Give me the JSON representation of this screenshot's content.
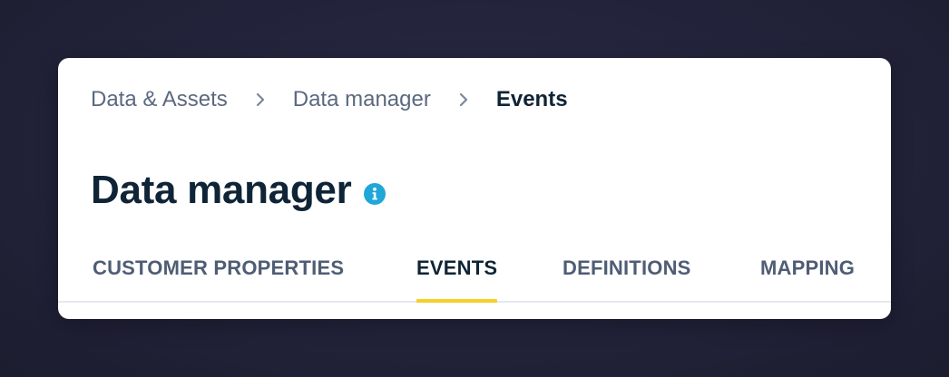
{
  "breadcrumb": {
    "items": [
      "Data & Assets",
      "Data manager",
      "Events"
    ]
  },
  "header": {
    "title": "Data manager",
    "info_icon": "info-icon"
  },
  "tabs": {
    "items": [
      {
        "label": "CUSTOMER PROPERTIES",
        "active": false
      },
      {
        "label": "EVENTS",
        "active": true
      },
      {
        "label": "DEFINITIONS",
        "active": false
      },
      {
        "label": "MAPPING",
        "active": false
      }
    ]
  },
  "colors": {
    "background": "#22223a",
    "card": "#ffffff",
    "title": "#0f2436",
    "muted": "#5b6880",
    "accent": "#f5d02a",
    "info": "#1fa7d8"
  }
}
